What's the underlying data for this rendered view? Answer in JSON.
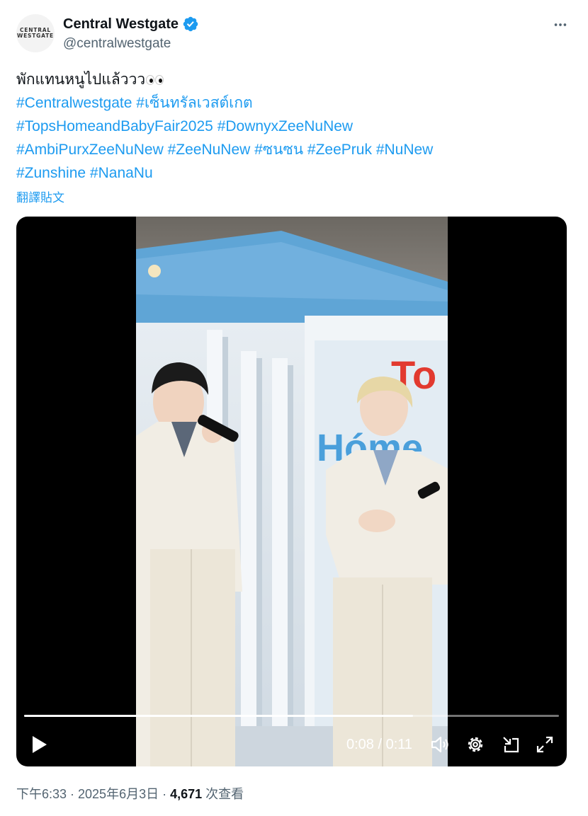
{
  "account": {
    "avatar_logo_line1": "CENTRAL",
    "avatar_logo_line2": "WESTGATE",
    "display_name": "Central Westgate",
    "handle": "@centralwestgate",
    "verified": true
  },
  "more_icon": "more-horizontal-icon",
  "tweet": {
    "text": "พักแทนหนูไปแล้ววว",
    "emoji": "eyes-emoji",
    "hashtags": [
      [
        "#Centralwestgate",
        "#เซ็นทรัลเวสต์เกต"
      ],
      [
        "#TopsHomeandBabyFair2025",
        "#DownyxZeeNuNew"
      ],
      [
        "#AmbiPurxZeeNuNew",
        "#ZeeNuNew",
        "#ซนซน",
        "#ZeePruk",
        "#NuNew"
      ],
      [
        "#Zunshine",
        "#NanaNu"
      ]
    ],
    "translate_link": "翻譯貼文"
  },
  "video": {
    "stage_sign_partial_1": "To",
    "stage_sign_partial_2": "Hóme",
    "time": "0:08 / 0:11",
    "progress": 0.727,
    "icons": [
      "play-icon",
      "volume-icon",
      "settings-icon",
      "pip-icon",
      "fullscreen-icon"
    ]
  },
  "footer": {
    "time_date": "下午6:33 · 2025年6月3日 · ",
    "views_count": "4,671",
    "views_label": " 次查看"
  },
  "colors": {
    "accent": "#1d9bf0",
    "text": "#0f1419",
    "secondary": "#536471",
    "stage_blue": "#5fa5d6"
  }
}
